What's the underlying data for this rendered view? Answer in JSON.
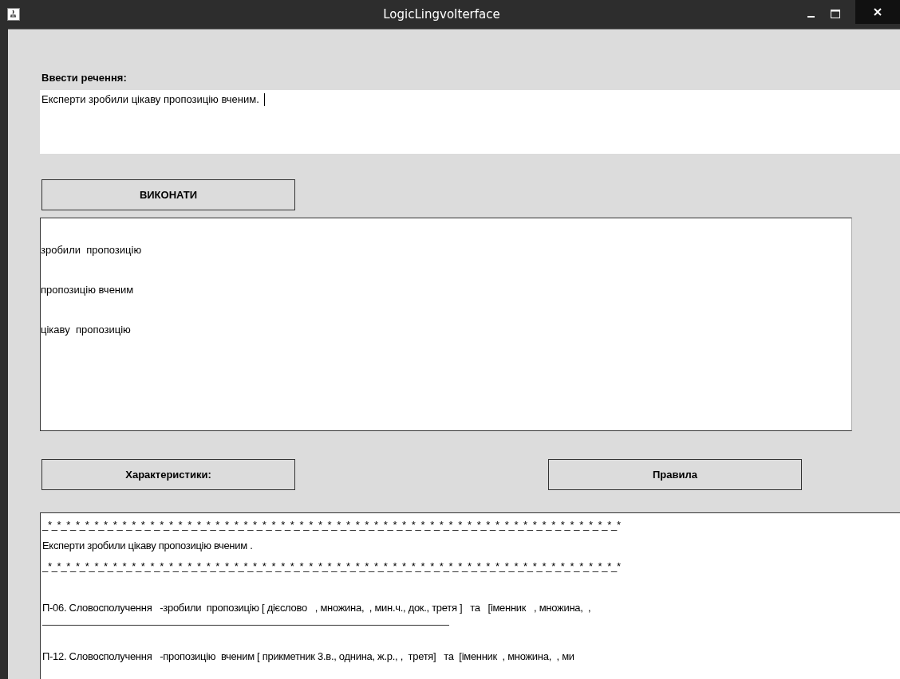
{
  "window": {
    "title": "LogicLingvoIterface"
  },
  "input": {
    "label": "Ввести речення:",
    "value": "Експерти зробили цікаву пропозицію вченим."
  },
  "run_button": "ВИКОНАТИ",
  "phrases": [
    "зробили  пропозицію",
    "пропозицію вченим",
    "цікаву  пропозицію"
  ],
  "buttons": [
    "Характеристики:",
    "Правила"
  ],
  "results": [
    {
      "kind": "text",
      "text": "_*_*_*_*_*_*_*_*_*_*_*_*_*_*_*_*_*_*_*_*_*_*_*_*_*_*_*_*_*_*_*_*_*_*_*_*_*_*_*_*_*_*_*_*_*_*_*_*_*_*_*_*_*_*_*_*_*_*_*_*_*_*"
    },
    {
      "kind": "text",
      "text": "Експерти зробили цікаву пропозицію вченим ."
    },
    {
      "kind": "text",
      "text": "_*_*_*_*_*_*_*_*_*_*_*_*_*_*_*_*_*_*_*_*_*_*_*_*_*_*_*_*_*_*_*_*_*_*_*_*_*_*_*_*_*_*_*_*_*_*_*_*_*_*_*_*_*_*_*_*_*_*_*_*_*_*"
    },
    {
      "kind": "gap"
    },
    {
      "kind": "text",
      "text": "П-06. Словосполучення   -зробили  пропозицію [ дієслово   , множина,  , мин.ч., док., третя ]   та   [іменник   , множина,  ,"
    },
    {
      "kind": "rule"
    },
    {
      "kind": "gap"
    },
    {
      "kind": "text",
      "text": "П-12. Словосполучення   -пропозицію  вченим [ прикметник 3.в., однина, ж.р., ,  третя]   та  [іменник  , множина,  , ми"
    }
  ]
}
